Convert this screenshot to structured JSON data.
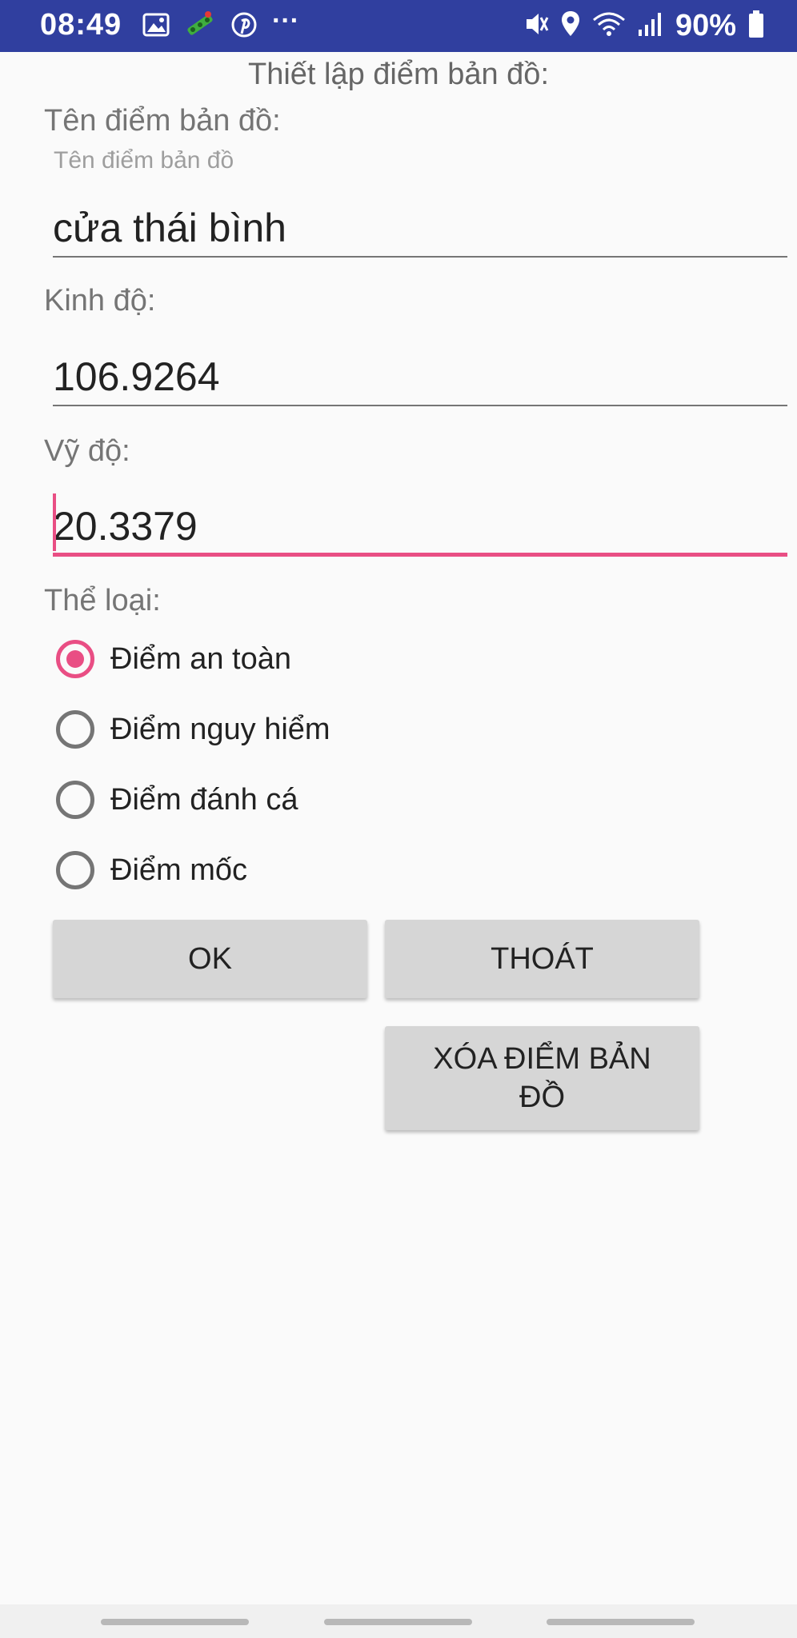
{
  "status_bar": {
    "time": "08:49",
    "battery": "90%",
    "more": "···",
    "icons_left": [
      "gallery-icon",
      "app-icon",
      "pinterest-icon",
      "more-icon"
    ],
    "icons_right": [
      "mute-icon",
      "location-icon",
      "wifi-icon",
      "signal-icon",
      "battery-icon"
    ]
  },
  "dialog": {
    "title": "Thiết lập điểm bản đồ:",
    "name_label": "Tên điểm bản đồ:",
    "name_hint": "Tên điểm bản đồ",
    "name_value": "cửa thái bình",
    "longitude_label": "Kinh độ:",
    "longitude_value": "106.9264",
    "latitude_label": "Vỹ độ:",
    "latitude_value": "20.3379",
    "category_label": "Thể loại:",
    "categories": [
      {
        "label": "Điểm an toàn",
        "checked": true
      },
      {
        "label": "Điểm nguy hiểm",
        "checked": false
      },
      {
        "label": "Điểm đánh cá",
        "checked": false
      },
      {
        "label": "Điểm mốc",
        "checked": false
      }
    ],
    "ok_label": "OK",
    "exit_label": "THOÁT",
    "delete_label": "XÓA ĐIỂM BẢN ĐỒ"
  },
  "colors": {
    "status_bar": "#303f9f",
    "accent": "#e94e84",
    "button": "#d6d6d6"
  }
}
